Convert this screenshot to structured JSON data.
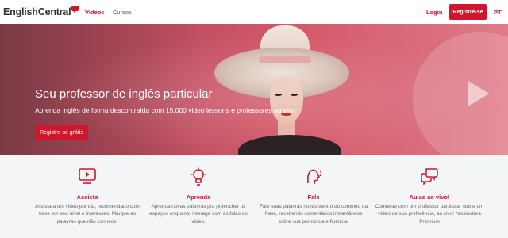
{
  "header": {
    "logo_text": "EnglishCentral",
    "nav": [
      {
        "label": "Vídeos",
        "active": true
      },
      {
        "label": "Cursos",
        "active": false
      }
    ],
    "login_label": "Login",
    "register_label": "Registre-se",
    "language": "PT"
  },
  "hero": {
    "title": "Seu professor de inglês particular",
    "subtitle": "Aprenda inglês de forma descontraída com 15.000 video lessons e professores ao vivo",
    "cta_label": "Registre-se grátis"
  },
  "features": [
    {
      "icon": "video-play-icon",
      "title": "Assista",
      "description": "Assista a um vídeo por dia, recomendado com base em seu nível e interesses. Marque as palavras que não conhece."
    },
    {
      "icon": "lightbulb-icon",
      "title": "Aprenda",
      "description": "Aprenda novas palavras pra preencher os espaços enquanto interage com as falas do vídeo."
    },
    {
      "icon": "speaking-icon",
      "title": "Fale",
      "description": "Fale suas palavras novas dentro do contexto da frase, recebendo comentários instantâneos sobre sua pronúncia e fluência."
    },
    {
      "icon": "chat-bubbles-icon",
      "title": "Aulas ao vivo!",
      "description": "Converse com um professor particular sobre um vídeo de sua preferência, ao vivo! *assinatura Premium"
    }
  ],
  "colors": {
    "brand_red": "#d0162d",
    "text_gray": "#666666",
    "features_bg": "#f3f5f7"
  }
}
